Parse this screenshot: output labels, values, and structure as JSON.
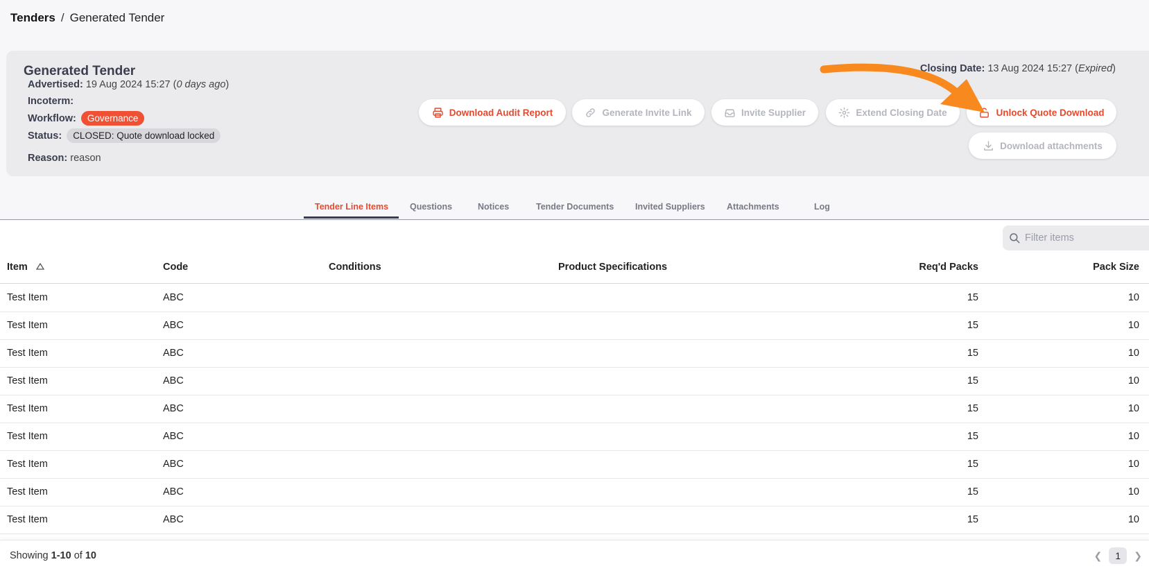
{
  "breadcrumb": {
    "root": "Tenders",
    "separator": "/",
    "current": "Generated Tender"
  },
  "tender": {
    "title": "Generated Tender",
    "advertised_label": "Advertised:",
    "advertised_value": "19 Aug 2024 15:27",
    "advertised_relative": "0 days ago",
    "incoterm_label": "Incoterm:",
    "incoterm_value": "",
    "workflow_label": "Workflow:",
    "workflow_value": "Governance",
    "status_label": "Status:",
    "status_value": "CLOSED: Quote download locked",
    "reason_label": "Reason:",
    "reason_value": "reason",
    "closing_label": "Closing Date:",
    "closing_value": "13 Aug 2024 15:27",
    "closing_state": "Expired"
  },
  "actions": {
    "download_audit_report": "Download Audit Report",
    "generate_invite_link": "Generate Invite Link",
    "invite_supplier": "Invite Supplier",
    "extend_closing_date": "Extend Closing Date",
    "unlock_quote_download": "Unlock Quote Download",
    "download_attachments": "Download attachments"
  },
  "tabs": [
    {
      "label": "Tender Line Items",
      "active": true
    },
    {
      "label": "Questions"
    },
    {
      "label": "Notices"
    },
    {
      "label": "Tender Documents"
    },
    {
      "label": "Invited Suppliers"
    },
    {
      "label": "Attachments"
    },
    {
      "label": "Log"
    }
  ],
  "filter": {
    "placeholder": "Filter items"
  },
  "table": {
    "columns": [
      "Item",
      "Code",
      "Conditions",
      "Product Specifications",
      "Req'd Packs",
      "Pack Size"
    ],
    "sort_icon": "triangle-up-icon",
    "rows": [
      [
        "Test Item",
        "ABC",
        "",
        "",
        "15",
        "10"
      ],
      [
        "Test Item",
        "ABC",
        "",
        "",
        "15",
        "10"
      ],
      [
        "Test Item",
        "ABC",
        "",
        "",
        "15",
        "10"
      ],
      [
        "Test Item",
        "ABC",
        "",
        "",
        "15",
        "10"
      ],
      [
        "Test Item",
        "ABC",
        "",
        "",
        "15",
        "10"
      ],
      [
        "Test Item",
        "ABC",
        "",
        "",
        "15",
        "10"
      ],
      [
        "Test Item",
        "ABC",
        "",
        "",
        "15",
        "10"
      ],
      [
        "Test Item",
        "ABC",
        "",
        "",
        "15",
        "10"
      ],
      [
        "Test Item",
        "ABC",
        "",
        "",
        "15",
        "10"
      ]
    ]
  },
  "pagination": {
    "showing_prefix": "Showing",
    "range": "1-10",
    "of": "of",
    "total": "10",
    "current_page": "1"
  },
  "colors": {
    "accent": "#e54a2e",
    "annotation_arrow": "#f7891f",
    "badge": "#f05033"
  }
}
